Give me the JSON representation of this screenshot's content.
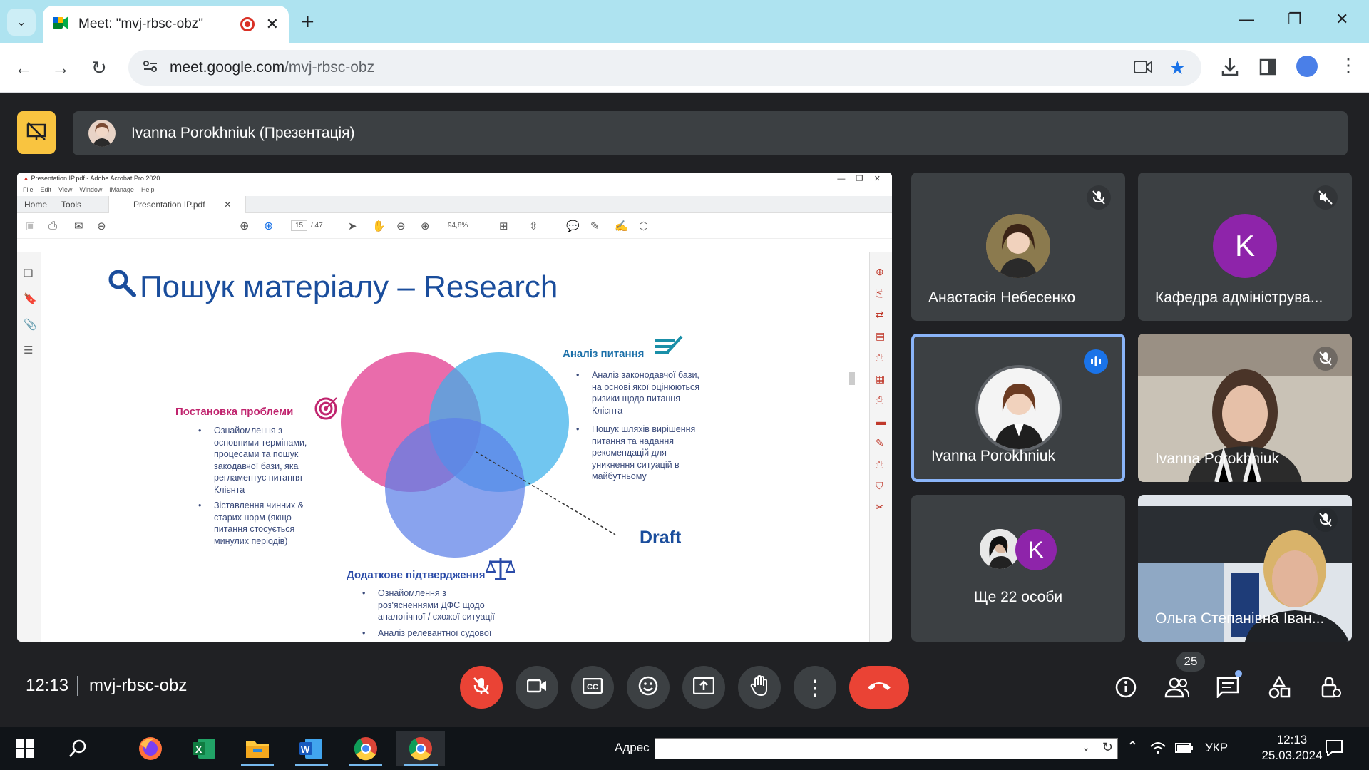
{
  "browser": {
    "tab_title": "Meet: \"mvj-rbsc-obz\"",
    "url_host": "meet.google.com",
    "url_path": "/mvj-rbsc-obz"
  },
  "banner": {
    "presenter_text": "Ivanna Porokhniuk (Презентація)"
  },
  "acrobat": {
    "title": "Presentation IP.pdf - Adobe Acrobat Pro 2020",
    "menu": [
      "File",
      "Edit",
      "View",
      "Window",
      "iManage",
      "Help"
    ],
    "tabs": {
      "home": "Home",
      "tools": "Tools",
      "doc": "Presentation IP.pdf"
    },
    "page_current": "15",
    "page_total": "/ 47",
    "zoom": "94,8%"
  },
  "slide": {
    "title": "Пошук матеріалу – Research",
    "left_title": "Постановка проблеми",
    "left_bullets": [
      "Ознайомлення з основними термінами, процесами та пошук закодавчої бази, яка регламентує питання Клієнта",
      "Зіставлення чинних & старих норм (якщо питання стосується минулих періодів)"
    ],
    "right_title": "Аналіз питання",
    "right_bullets": [
      "Аналіз законодавчої бази, на основі якої оцінюються ризики щодо питання Клієнта",
      "Пошук шляхів вирішення питання та надання рекомендацій для уникнення ситуацій в майбутньому"
    ],
    "bottom_title": "Додаткове підтвердження",
    "bottom_bullets": [
      "Ознайомлення з роз'ясненнями ДФС щодо аналогічної / схожої ситуації",
      "Аналіз релевантної судової практики"
    ],
    "draft_label": "Draft"
  },
  "participants": [
    {
      "name": "Анастасія Небесенко",
      "muted": true
    },
    {
      "name": "Кафедра адмініструва...",
      "initial": "K",
      "muted": true
    },
    {
      "name": "Ivanna Porokhniuk",
      "speaking": true
    },
    {
      "name": "Ivanna Porokhniuk",
      "muted": true
    },
    {
      "name": "Ще 22 особи",
      "initial": "K"
    },
    {
      "name": "Ольга Степанівна Іван...",
      "muted": true
    }
  ],
  "bottom": {
    "time": "12:13",
    "meeting_code": "mvj-rbsc-obz",
    "people_count": "25"
  },
  "taskbar": {
    "address_label": "Адрес",
    "language": "УКР",
    "clock_time": "12:13",
    "clock_date": "25.03.2024"
  },
  "colors": {
    "accent_yellow": "#f9c440",
    "danger_red": "#ea4335",
    "active_blue": "#8ab4f8",
    "meet_bg": "#202124"
  }
}
